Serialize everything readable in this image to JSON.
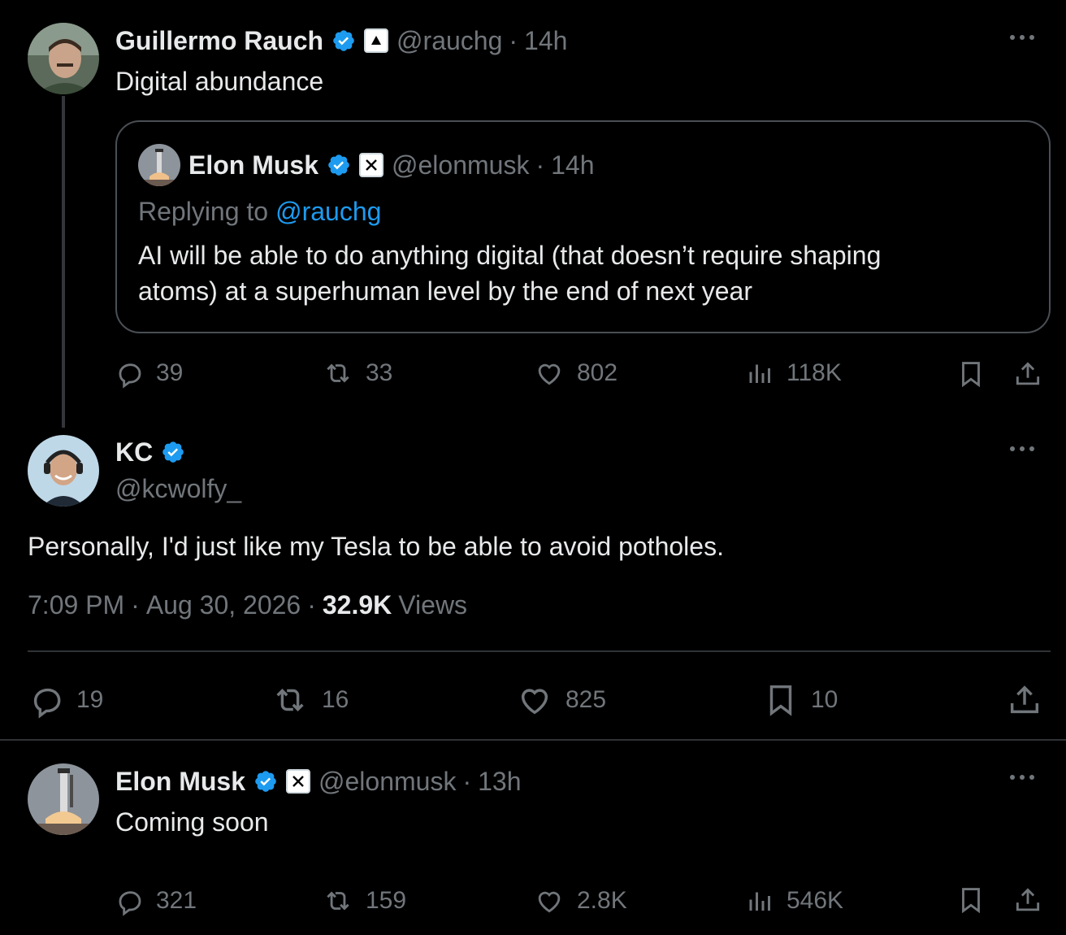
{
  "tweet1": {
    "author_name": "Guillermo Rauch",
    "handle": "@rauchg",
    "sep": "·",
    "time": "14h",
    "text": "Digital abundance",
    "quote": {
      "author_name": "Elon Musk",
      "handle": "@elonmusk",
      "sep": "·",
      "time": "14h",
      "replying_prefix": "Replying to",
      "replying_handle": "@rauchg",
      "text_line1": "AI will be able to do anything digital (that doesn’t require shaping",
      "text_line2": "atoms) at a superhuman level by the end of next year"
    },
    "actions": {
      "replies": "39",
      "reposts": "33",
      "likes": "802",
      "views": "118K"
    }
  },
  "tweet2": {
    "author_name": "KC",
    "handle": "@kcwolfy_",
    "text": "Personally, I'd just like my Tesla to be able to avoid potholes.",
    "time": "7:09 PM",
    "sep1": "·",
    "date": "Aug 30, 2026",
    "sep2": "·",
    "views_count": "32.9K",
    "views_label": "Views",
    "actions": {
      "replies": "19",
      "reposts": "16",
      "likes": "825",
      "bookmarks": "10"
    }
  },
  "tweet3": {
    "author_name": "Elon Musk",
    "handle": "@elonmusk",
    "sep": "·",
    "time": "13h",
    "text": "Coming soon",
    "actions": {
      "replies": "321",
      "reposts": "159",
      "likes": "2.8K",
      "views": "546K"
    }
  },
  "colors": {
    "background": "#000000",
    "text": "#e7e9ea",
    "muted": "#71767b",
    "accent": "#1d9bf0",
    "border": "#2f3336"
  },
  "icons": [
    "reply-icon",
    "repost-icon",
    "like-icon",
    "views-icon",
    "bookmark-icon",
    "share-icon",
    "more-icon",
    "verified-badge-icon",
    "affiliate-x-icon"
  ]
}
